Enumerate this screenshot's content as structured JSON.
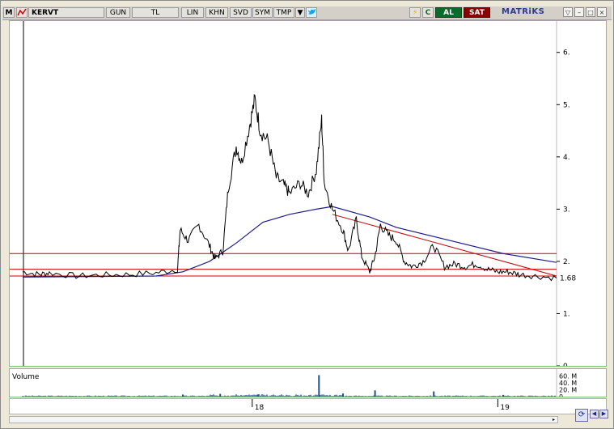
{
  "toolbar": {
    "symbol": "KERVT",
    "period": "GUN",
    "currency": "TL",
    "buttons": [
      "LIN",
      "KHN",
      "SVD",
      "SYM",
      "TMP"
    ],
    "al_label": "AL",
    "sat_label": "SAT",
    "brand": "MATRiKS",
    "m_label": "M"
  },
  "colors": {
    "price": "#000000",
    "moving_average": "#1c1c8c",
    "horizontal_lines": "#cc0000",
    "volume": "#1f4f8f",
    "panel_border": "#7fbf7f",
    "al": "#0a6b2a",
    "sat": "#8b0000"
  },
  "chart_data": {
    "type": "line",
    "y_ticks": [
      "6.",
      "5.",
      "4.",
      "3.",
      "2.",
      "1.",
      "0"
    ],
    "y_range": [
      0,
      6.6
    ],
    "x_ticks": [
      "18",
      "19"
    ],
    "price_label": "1.68",
    "horizontal_levels": [
      2.15,
      1.85,
      1.72
    ],
    "trendline": [
      [
        0.58,
        2.9
      ],
      [
        1.0,
        1.72
      ]
    ],
    "price_series": [
      [
        0.0,
        1.8
      ],
      [
        0.03,
        1.75
      ],
      [
        0.05,
        1.78
      ],
      [
        0.1,
        1.72
      ],
      [
        0.15,
        1.74
      ],
      [
        0.2,
        1.75
      ],
      [
        0.25,
        1.78
      ],
      [
        0.29,
        1.85
      ],
      [
        0.295,
        2.6
      ],
      [
        0.31,
        2.4
      ],
      [
        0.33,
        2.7
      ],
      [
        0.35,
        2.3
      ],
      [
        0.36,
        2.05
      ],
      [
        0.375,
        2.2
      ],
      [
        0.385,
        3.4
      ],
      [
        0.4,
        4.2
      ],
      [
        0.41,
        3.9
      ],
      [
        0.425,
        4.6
      ],
      [
        0.435,
        5.1
      ],
      [
        0.445,
        4.5
      ],
      [
        0.46,
        4.3
      ],
      [
        0.475,
        3.6
      ],
      [
        0.49,
        3.45
      ],
      [
        0.5,
        3.3
      ],
      [
        0.52,
        3.5
      ],
      [
        0.535,
        3.3
      ],
      [
        0.55,
        3.75
      ],
      [
        0.56,
        4.7
      ],
      [
        0.565,
        3.5
      ],
      [
        0.58,
        3.0
      ],
      [
        0.6,
        2.6
      ],
      [
        0.61,
        2.2
      ],
      [
        0.625,
        2.8
      ],
      [
        0.635,
        2.1
      ],
      [
        0.65,
        1.8
      ],
      [
        0.66,
        2.1
      ],
      [
        0.67,
        2.7
      ],
      [
        0.685,
        2.5
      ],
      [
        0.7,
        2.4
      ],
      [
        0.715,
        2.0
      ],
      [
        0.73,
        1.9
      ],
      [
        0.75,
        2.0
      ],
      [
        0.77,
        2.3
      ],
      [
        0.79,
        1.9
      ],
      [
        0.81,
        1.95
      ],
      [
        0.83,
        1.9
      ],
      [
        0.85,
        1.95
      ],
      [
        0.87,
        1.85
      ],
      [
        0.89,
        1.8
      ],
      [
        0.91,
        1.8
      ],
      [
        0.93,
        1.75
      ],
      [
        0.96,
        1.72
      ],
      [
        1.0,
        1.68
      ]
    ],
    "ma_series": [
      [
        0.0,
        1.7
      ],
      [
        0.25,
        1.72
      ],
      [
        0.3,
        1.8
      ],
      [
        0.35,
        2.0
      ],
      [
        0.4,
        2.35
      ],
      [
        0.45,
        2.75
      ],
      [
        0.5,
        2.9
      ],
      [
        0.55,
        3.0
      ],
      [
        0.58,
        3.05
      ],
      [
        0.65,
        2.85
      ],
      [
        0.7,
        2.65
      ],
      [
        0.8,
        2.4
      ],
      [
        0.9,
        2.15
      ],
      [
        1.0,
        1.98
      ]
    ],
    "volume_label": "Volume",
    "volume_ticks": [
      "60. M",
      "40. M",
      "20. M",
      "0"
    ],
    "volume_range": [
      0,
      70
    ],
    "volume_spikes": [
      [
        0.555,
        62
      ],
      [
        0.66,
        18
      ],
      [
        0.77,
        15
      ],
      [
        0.3,
        6
      ],
      [
        0.37,
        8
      ],
      [
        0.44,
        6
      ],
      [
        0.6,
        9
      ],
      [
        0.9,
        5
      ]
    ]
  }
}
